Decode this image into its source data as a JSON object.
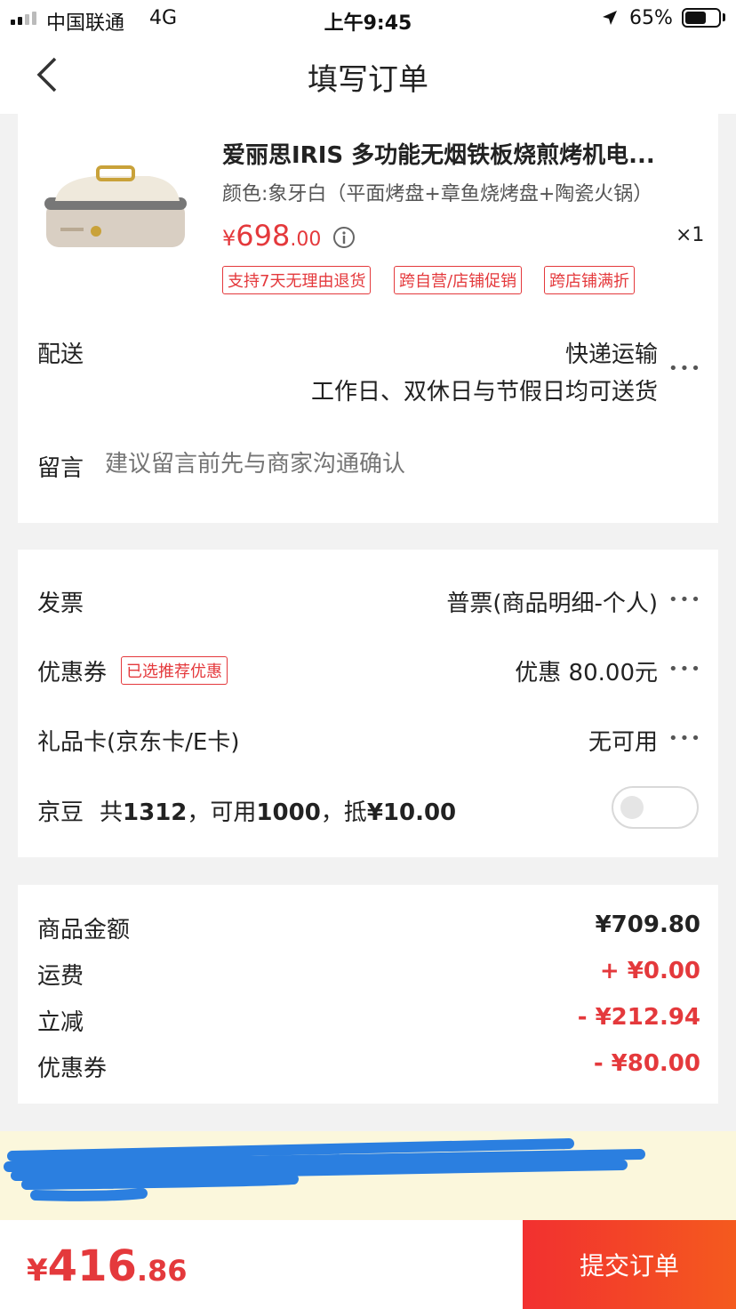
{
  "status_bar": {
    "carrier": "中国联通",
    "network": "4G",
    "time": "上午9:45",
    "battery": "65%",
    "battery_level": 0.65,
    "icons": [
      "signal-icon",
      "location-arrow-icon",
      "battery-icon"
    ]
  },
  "nav": {
    "title": "填写订单",
    "back_icon": "back-chevron-icon"
  },
  "product": {
    "name": "爱丽思IRIS 多功能无烟铁板烧煎烤机电...",
    "spec": "颜色:象牙白（平面烤盘+章鱼烧烤盘+陶瓷火锅）",
    "price_symbol": "¥",
    "price_int": "698",
    "price_dec": ".00",
    "quantity": "×1",
    "tags": [
      "支持7天无理由退货",
      "跨自营/店铺促销",
      "跨店铺满折"
    ],
    "info_icon": "info-icon",
    "image_icon": "grill-product-image"
  },
  "delivery": {
    "label": "配送",
    "method": "快递运输",
    "note": "工作日、双休日与节假日均可送货",
    "more": "•••"
  },
  "message": {
    "label": "留言",
    "placeholder": "建议留言前先与商家沟通确认"
  },
  "invoice": {
    "label": "发票",
    "value": "普票(商品明细-个人)",
    "more": "•••"
  },
  "coupon": {
    "label": "优惠券",
    "tag": "已选推荐优惠",
    "value": "优惠 80.00元",
    "more": "•••"
  },
  "gift_card": {
    "label": "礼品卡(京东卡/E卡)",
    "value": "无可用",
    "more": "•••"
  },
  "jingdou": {
    "label": "京豆",
    "text_prefix": "共",
    "total": "1312",
    "text_mid": "，可用",
    "usable": "1000",
    "text_mid2": "，抵",
    "deduct": "¥10.00",
    "enabled": false
  },
  "summary": {
    "rows": [
      {
        "label": "商品金额",
        "value": "¥709.80",
        "color": "#222222"
      },
      {
        "label": "运费",
        "value": "+ ¥0.00",
        "color": "#e4393c"
      },
      {
        "label": "立减",
        "value": "- ¥212.94",
        "color": "#e4393c"
      },
      {
        "label": "优惠券",
        "value": "- ¥80.00",
        "color": "#e4393c"
      }
    ]
  },
  "footer": {
    "total_symbol": "¥",
    "total_int": "416",
    "total_dec": ".86",
    "submit_label": "提交订单"
  },
  "colors": {
    "accent": "#e4393c",
    "submit_gradient_start": "#f23030",
    "submit_gradient_end": "#f45a1e",
    "banner_bg": "#fbf7dc",
    "redaction": "#2b7fe0"
  }
}
